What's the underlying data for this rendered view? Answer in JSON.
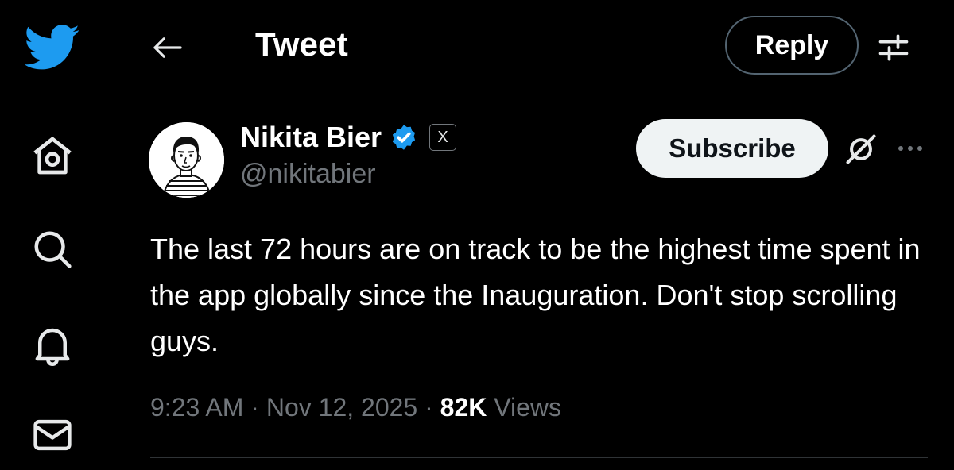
{
  "header": {
    "title": "Tweet",
    "reply_label": "Reply"
  },
  "author": {
    "name": "Nikita Bier",
    "handle": "@nikitabier",
    "badge": "X",
    "subscribe_label": "Subscribe"
  },
  "tweet": {
    "text": "The last 72 hours are on track to be the highest time spent in the app globally since the Inauguration. Don't stop scrolling guys.",
    "time": "9:23 AM",
    "date": "Nov 12, 2025",
    "views_count": "82K",
    "views_label": "Views"
  },
  "colors": {
    "accent": "#1d9bf0",
    "background": "#000000",
    "muted": "#71767b"
  }
}
